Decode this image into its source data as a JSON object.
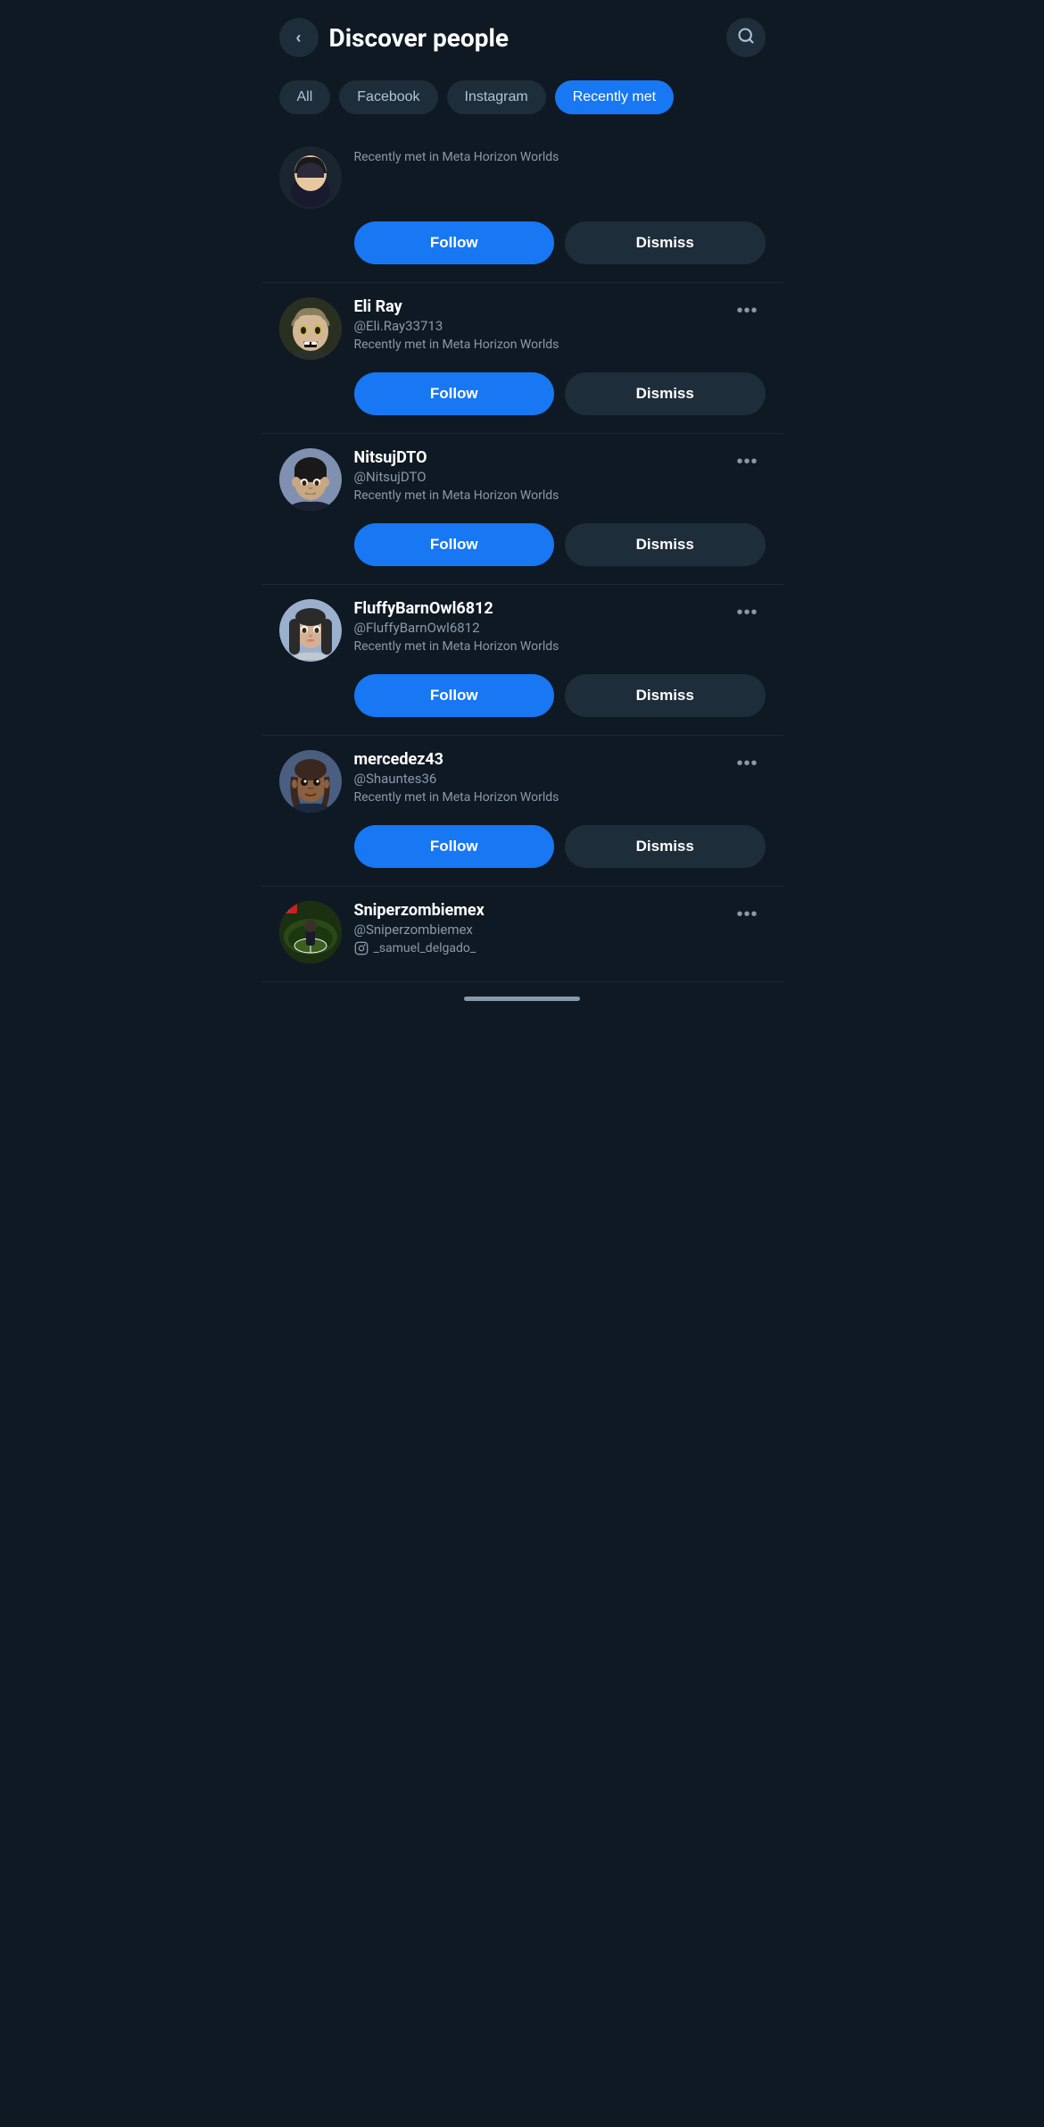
{
  "header": {
    "title": "Discover people",
    "back_label": "back",
    "search_label": "search"
  },
  "filters": [
    {
      "id": "all",
      "label": "All",
      "active": false
    },
    {
      "id": "facebook",
      "label": "Facebook",
      "active": false
    },
    {
      "id": "instagram",
      "label": "Instagram",
      "active": false
    },
    {
      "id": "recently_met",
      "label": "Recently met",
      "active": true
    }
  ],
  "users": [
    {
      "id": "user_0",
      "name": "",
      "handle": "",
      "context": "Recently met in Meta Horizon Worlds",
      "avatar_type": "first",
      "show_more": false
    },
    {
      "id": "user_eli",
      "name": "Eli Ray",
      "handle": "@Eli.Ray33713",
      "context": "Recently met in Meta Horizon Worlds",
      "avatar_type": "eli",
      "show_more": true
    },
    {
      "id": "user_nitsuj",
      "name": "NitsujDTO",
      "handle": "@NitsujDTO",
      "context": "Recently met in Meta Horizon Worlds",
      "avatar_type": "nitsuj",
      "show_more": true
    },
    {
      "id": "user_fluffy",
      "name": "FluffyBarnOwl6812",
      "handle": "@FluffyBarnOwl6812",
      "context": "Recently met in Meta Horizon Worlds",
      "avatar_type": "fluffy",
      "show_more": true
    },
    {
      "id": "user_mercedez",
      "name": "mercedez43",
      "handle": "@Shauntes36",
      "context": "Recently met in Meta Horizon Worlds",
      "avatar_type": "mercedez",
      "show_more": true
    },
    {
      "id": "user_sniper",
      "name": "Sniperzombiemex",
      "handle": "@Sniperzombiemex",
      "context": "_samuel_delgado_",
      "avatar_type": "sniper",
      "show_more": true
    }
  ],
  "buttons": {
    "follow": "Follow",
    "dismiss": "Dismiss"
  },
  "colors": {
    "accent": "#1877f2",
    "background": "#0f1923",
    "card_bg": "#1e2d3a",
    "text_secondary": "#8899aa"
  }
}
